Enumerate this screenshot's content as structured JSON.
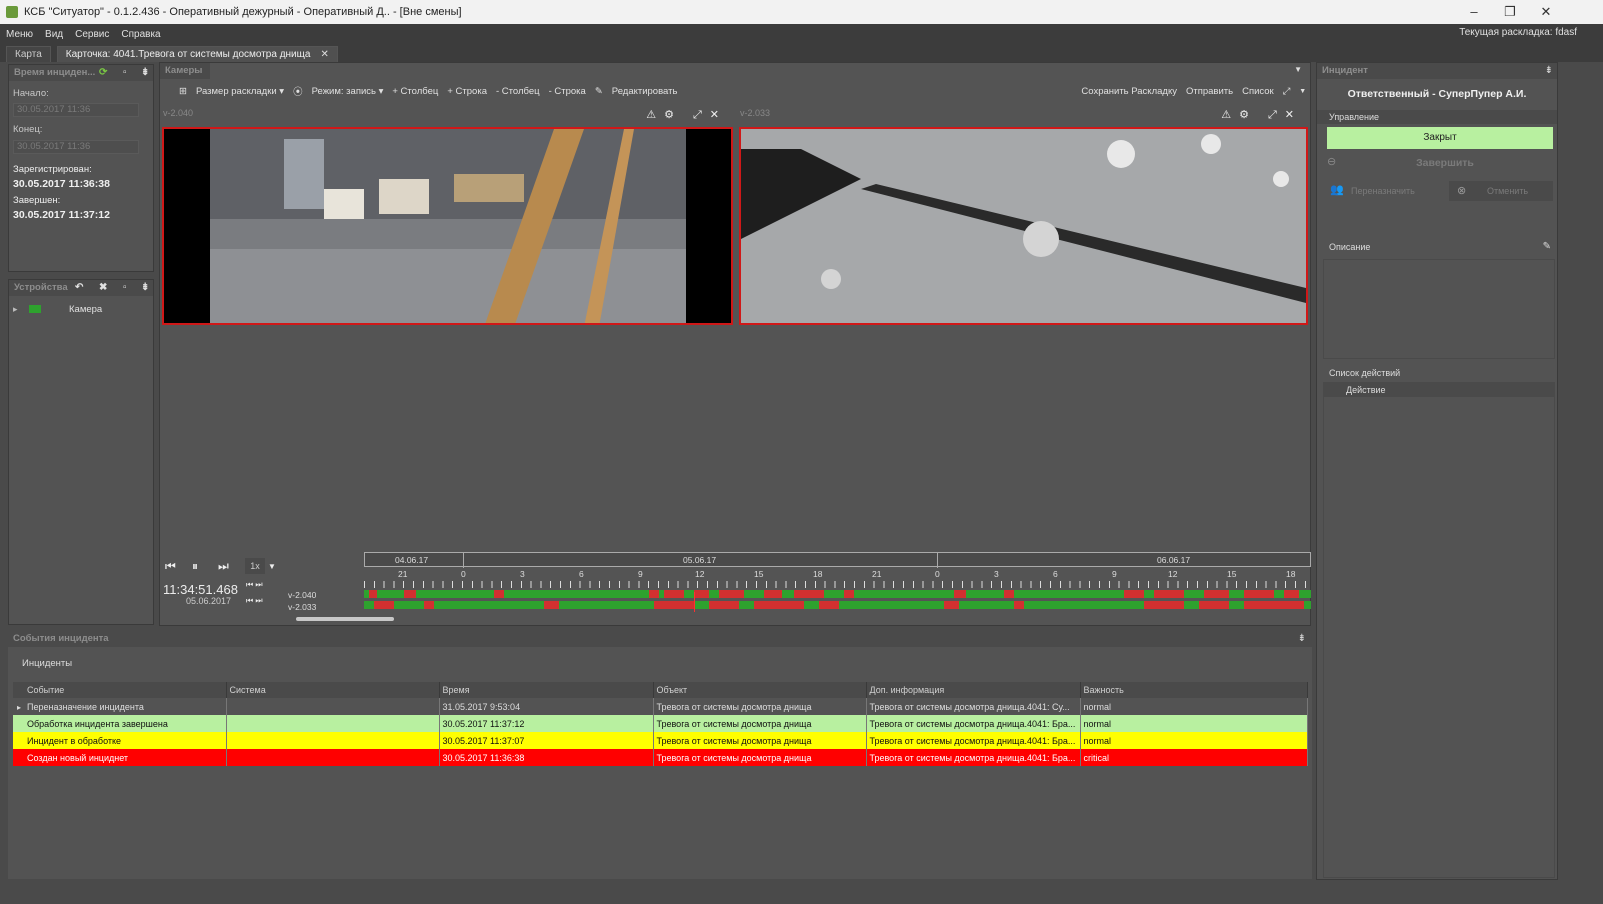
{
  "window": {
    "title": "КСБ \"Ситуатор\" - 0.1.2.436 - Оперативный дежурный - Оперативный Д.. - [Вне смены]",
    "min": "–",
    "max": "❐",
    "close": "✕"
  },
  "menu": {
    "items": [
      "Меню",
      "Вид",
      "Сервис",
      "Справка"
    ],
    "layout_label": "Текущая раскладка: fdasf"
  },
  "tabs": [
    {
      "label": "Карта"
    },
    {
      "label": "Карточка: 4041.Тревога от системы досмотра днища",
      "close": "✕"
    }
  ],
  "time_panel": {
    "title": "Время инциден...",
    "start_label": "Начало:",
    "start_value": "30.05.2017 11:36",
    "end_label": "Конец:",
    "end_value": "30.05.2017 11:36",
    "registered_label": "Зарегистрирован:",
    "registered_value": "30.05.2017 11:36:38",
    "finished_label": "Завершен:",
    "finished_value": "30.05.2017 11:37:12"
  },
  "devices_panel": {
    "title": "Устройства",
    "item_label": "Камера"
  },
  "cameras_panel": {
    "title": "Камеры",
    "toolbar": {
      "layout_size": "Размер раскладки ▾",
      "mode": "Режим: запись ▾",
      "add_col": "+ Столбец",
      "add_row": "+ Строка",
      "rem_col": "- Столбец",
      "rem_row": "- Строка",
      "edit": "Редактировать",
      "save_layout": "Сохранить Раскладку",
      "send": "Отправить",
      "list": "Список"
    },
    "video1_name": "v-2.040",
    "video2_name": "v-2.033"
  },
  "player": {
    "speed": "1x",
    "time": "11:34:51.468",
    "date": "05.06.2017",
    "track1": "v-2.040",
    "track2": "v-2.033",
    "dates": [
      "04.06.17",
      "05.06.17",
      "06.06.17"
    ],
    "hours": [
      "21",
      "0",
      "3",
      "6",
      "9",
      "12",
      "15",
      "18",
      "21",
      "0",
      "3",
      "6",
      "9",
      "12",
      "15",
      "18"
    ]
  },
  "events_panel": {
    "title": "События инцидента",
    "subtitle": "Инциденты",
    "columns": [
      "Событие",
      "Система",
      "Время",
      "Объект",
      "Доп. информация",
      "Важность"
    ],
    "rows": [
      {
        "event": "Переназначение инцидента",
        "system": "",
        "time": "31.05.2017 9:53:04",
        "object": "Тревога от системы досмотра днища",
        "info": "Тревога от системы досмотра днища.4041: Су...",
        "severity": "normal",
        "style": "n"
      },
      {
        "event": "Обработка инцидента завершена",
        "system": "",
        "time": "30.05.2017 11:37:12",
        "object": "Тревога от системы досмотра днища",
        "info": "Тревога от системы досмотра днища.4041: Бра...",
        "severity": "normal",
        "style": "g"
      },
      {
        "event": "Инцидент в обработке",
        "system": "",
        "time": "30.05.2017 11:37:07",
        "object": "Тревога от системы досмотра днища",
        "info": "Тревога от системы досмотра днища.4041: Бра...",
        "severity": "normal",
        "style": "y"
      },
      {
        "event": "Создан новый инциднет",
        "system": "",
        "time": "30.05.2017 11:36:38",
        "object": "Тревога от системы досмотра днища",
        "info": "Тревога от системы досмотра днища.4041: Бра...",
        "severity": "critical",
        "style": "rd"
      }
    ]
  },
  "incident_panel": {
    "title": "Инцидент",
    "responsible": "Ответственный - СуперПупер А.И.",
    "control_label": "Управление",
    "status_button": "Закрыт",
    "finish_button": "Завершить",
    "reassign_button": "Переназначить",
    "cancel_button": "Отменить",
    "description_label": "Описание",
    "actions_label": "Список действий",
    "actions_col": "Действие"
  },
  "colors": {
    "accent_red": "#d01818",
    "status_green": "#b8f0a0",
    "track_green": "#2ea22e",
    "track_red": "#d23030"
  }
}
